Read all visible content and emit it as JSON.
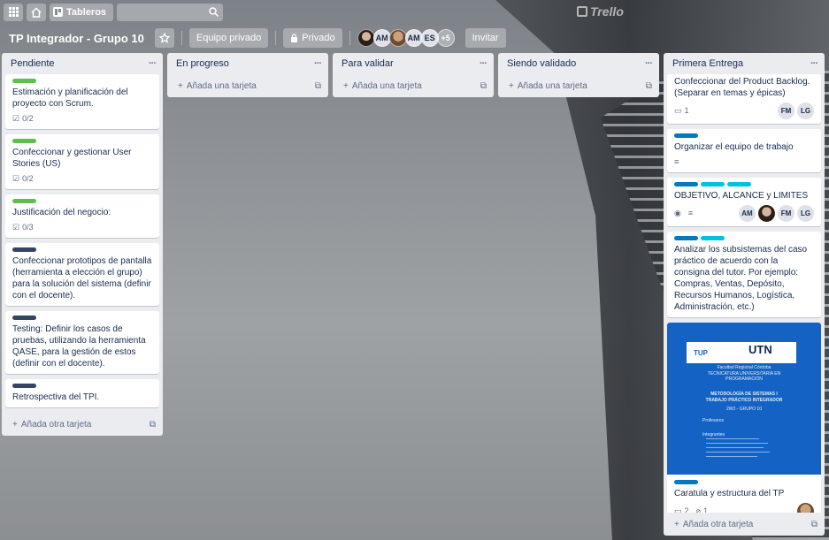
{
  "topbar": {
    "boards_label": "Tableros",
    "logo_text": "Trello",
    "search_placeholder": ""
  },
  "board": {
    "title": "TP Integrador - Grupo 10",
    "team_label": "Equipo privado",
    "visibility_label": "Privado",
    "members": [
      "AM",
      "AM",
      "ES"
    ],
    "more_members": "+5",
    "invite_label": "Invitar"
  },
  "lists": [
    {
      "title": "Pendiente",
      "cards": [
        {
          "labels": [
            "#61bd4f"
          ],
          "text": "Estimación y planificación del proyecto con Scrum.",
          "checklist": "0/2"
        },
        {
          "labels": [
            "#61bd4f"
          ],
          "text": "Confeccionar y gestionar User Stories (US)",
          "checklist": "0/2"
        },
        {
          "labels": [
            "#61bd4f"
          ],
          "text": "Justificación del negocio:",
          "checklist": "0/3"
        },
        {
          "labels": [
            "#344563"
          ],
          "text": "Confeccionar prototipos de pantalla (herramienta a elección el grupo) para la solución del sistema (definir con el docente)."
        },
        {
          "labels": [
            "#344563"
          ],
          "text": "Testing: Definir los casos de pruebas, utilizando la herramienta QASE, para la gestión de estos (definir con el docente)."
        },
        {
          "labels": [
            "#344563"
          ],
          "text": "Retrospectiva del TPI."
        }
      ],
      "add_label": "Añada otra tarjeta"
    },
    {
      "title": "En progreso",
      "cards": [],
      "add_label": "Añada una tarjeta"
    },
    {
      "title": "Para validar",
      "cards": [],
      "add_label": "Añada una tarjeta"
    },
    {
      "title": "Siendo validado",
      "cards": [],
      "add_label": "Añada una tarjeta"
    },
    {
      "title": "Primera Entrega",
      "cards": [
        {
          "text": "Confeccionar del Product Backlog. (Separar en temas y épicas)",
          "comments": "1",
          "members": [
            "FM",
            "LG"
          ]
        },
        {
          "labels": [
            "#0079bf"
          ],
          "text": "Organizar el equipo de trabajo"
        },
        {
          "labels": [
            "#0079bf",
            "#00c2e0",
            "#00c2e0"
          ],
          "text": "OBJETIVO, ALCANCE y LIMITES",
          "members": [
            "AM",
            "FM",
            "LG"
          ]
        },
        {
          "labels": [
            "#0079bf",
            "#00c2e0"
          ],
          "text": "Analizar los subsistemas del caso práctico de acuerdo con la consigna del tutor. Por ejemplo: Compras, Ventas, Depósito, Recursos Humanos, Logística, Administración, etc.)"
        },
        {
          "labels": [
            "#0079bf"
          ],
          "text": "Caratula y estructura del TP",
          "comments": "2",
          "attachments": "1",
          "cover": {
            "tup": "TUP",
            "utn": "UTN",
            "utn_sub": "Facultad Regional Córdoba",
            "line1": "TECNICATURA UNIVERSITARIA EN",
            "line2": "PROGRAMACIÓN",
            "title": "METODOLOGÍA DE SISTEMAS I",
            "subtitle": "TRABAJO PRÁCTICO INTEGRADOR",
            "group": "2W2 - GRUPO 10",
            "profesores": "Profesores",
            "integrantes": "Integrantes"
          }
        },
        {
          "labels": [
            "#0079bf",
            "#00c2e0"
          ],
          "text": ""
        }
      ],
      "add_label": "Añada otra tarjeta"
    }
  ]
}
